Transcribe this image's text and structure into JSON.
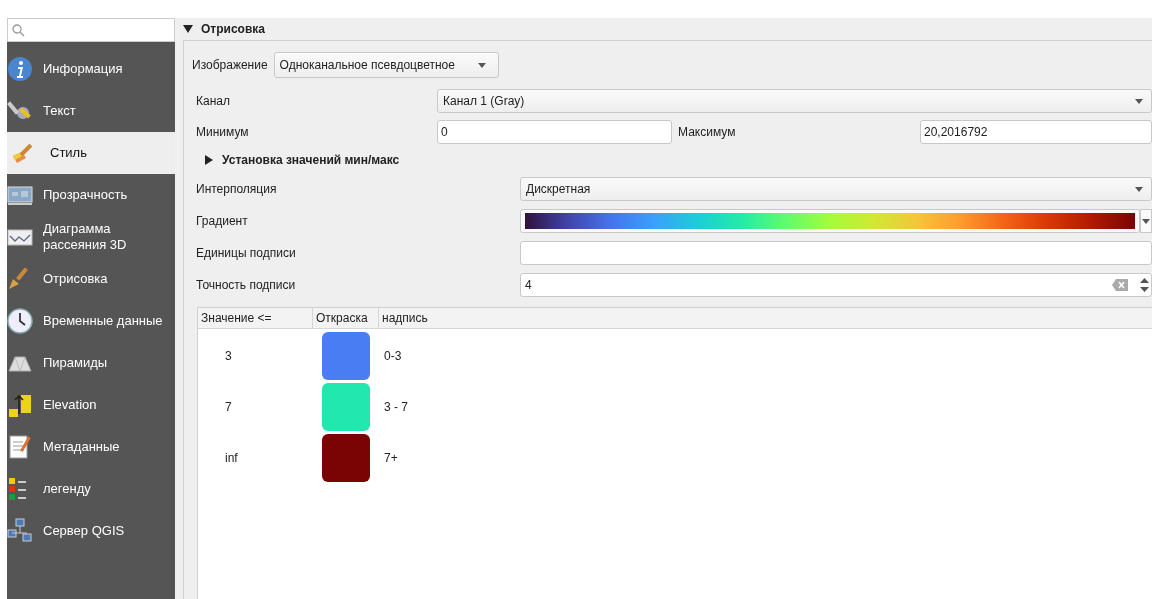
{
  "sidebar": {
    "items": [
      {
        "label": "Информация",
        "selected": false
      },
      {
        "label": "Текст",
        "selected": false
      },
      {
        "label": "Стиль",
        "selected": true
      },
      {
        "label": "Прозрачность",
        "selected": false
      },
      {
        "label": "Диаграмма рассеяния 3D",
        "selected": false
      },
      {
        "label": "Отрисовка",
        "selected": false
      },
      {
        "label": "Временные данные",
        "selected": false
      },
      {
        "label": "Пирамиды",
        "selected": false
      },
      {
        "label": "Elevation",
        "selected": false
      },
      {
        "label": "Метаданные",
        "selected": false
      },
      {
        "label": "легенду",
        "selected": false
      },
      {
        "label": "Сервер QGIS",
        "selected": false
      }
    ]
  },
  "section": {
    "title": "Отрисовка",
    "expanded": true
  },
  "render_type": {
    "label": "Изображение",
    "value": "Одноканальное псевдоцветное"
  },
  "band": {
    "label": "Канал",
    "value": "Канал 1 (Gray)"
  },
  "minimum": {
    "label": "Минимум",
    "value": "0"
  },
  "maximum": {
    "label": "Максимум",
    "value": "20,2016792"
  },
  "minmax_section": {
    "title": "Установка значений мин/макс",
    "expanded": false
  },
  "interpolation": {
    "label": "Интерполяция",
    "value": "Дискретная"
  },
  "gradient": {
    "label": "Градиент"
  },
  "label_unit": {
    "label": "Единицы подписи"
  },
  "label_precision": {
    "label": "Точность подписи",
    "value": "4"
  },
  "table": {
    "columns": [
      "Значение <=",
      "Откраска",
      "надпись"
    ],
    "rows": [
      {
        "value": "3",
        "color": "#497ef3",
        "label": "0-3"
      },
      {
        "value": "7",
        "color": "#22e8b0",
        "label": "3 - 7"
      },
      {
        "value": "inf",
        "color": "#7a0403",
        "label": "7+"
      }
    ]
  }
}
